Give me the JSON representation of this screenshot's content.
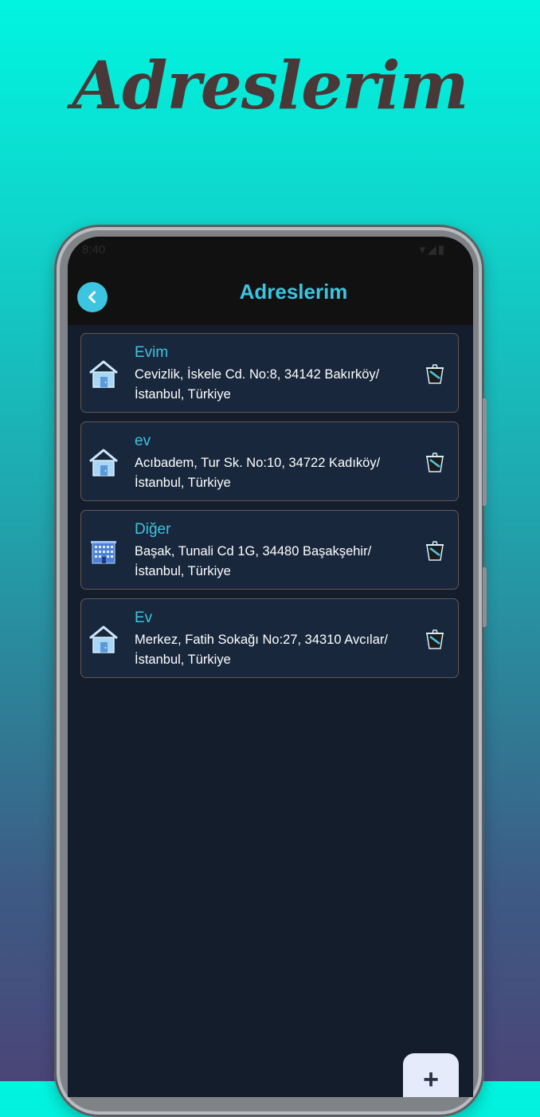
{
  "promo": {
    "title": "Adreslerim"
  },
  "status_bar": {
    "time": "8:40"
  },
  "app_bar": {
    "title": "Adreslerim"
  },
  "addresses": [
    {
      "name": "Evim",
      "address": "Cevizlik, İskele Cd. No:8, 34142 Bakırköy/ İstanbul, Türkiye",
      "icon": "home-icon"
    },
    {
      "name": "ev",
      "address": "Acıbadem, Tur Sk. No:10, 34722 Kadıköy/ İstanbul, Türkiye",
      "icon": "home-icon"
    },
    {
      "name": "Diğer",
      "address": "Başak, Tunali Cd 1G, 34480 Başakşehir/ İstanbul, Türkiye",
      "icon": "building-icon"
    },
    {
      "name": "Ev",
      "address": "Merkez, Fatih Sokağı No:27, 34310 Avcılar/ İstanbul, Türkiye",
      "icon": "home-icon"
    }
  ],
  "fab": {
    "label": "+"
  },
  "colors": {
    "accent": "#3cc4e0",
    "card_bg": "#18273c",
    "screen_bg": "#141d2b",
    "title": "#4a3838"
  }
}
